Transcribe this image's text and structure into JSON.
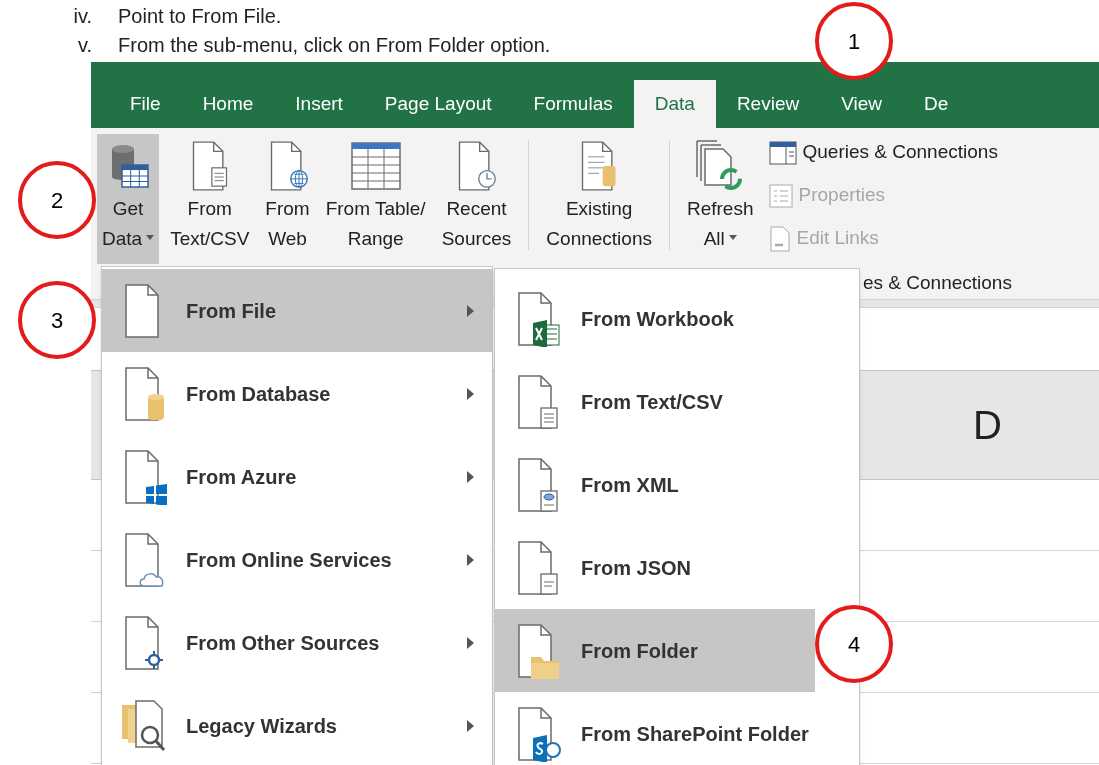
{
  "instructions": [
    {
      "number": "iv.",
      "text": "Point to From File."
    },
    {
      "number": "v.",
      "text": "From the sub-menu, click on From Folder option."
    }
  ],
  "tabs": [
    {
      "label": "File",
      "selected": false
    },
    {
      "label": "Home",
      "selected": false
    },
    {
      "label": "Insert",
      "selected": false
    },
    {
      "label": "Page Layout",
      "selected": false
    },
    {
      "label": "Formulas",
      "selected": false
    },
    {
      "label": "Data",
      "selected": true
    },
    {
      "label": "Review",
      "selected": false
    },
    {
      "label": "View",
      "selected": false
    },
    {
      "label": "De",
      "selected": false
    }
  ],
  "ribbon": {
    "large_buttons": [
      {
        "lines": [
          "Get",
          "Data"
        ],
        "has_menu": true,
        "selected": true
      },
      {
        "lines": [
          "From",
          "Text/CSV"
        ],
        "has_menu": false,
        "selected": false
      },
      {
        "lines": [
          "From",
          "Web"
        ],
        "has_menu": false,
        "selected": false
      },
      {
        "lines": [
          "From Table/",
          "Range"
        ],
        "has_menu": false,
        "selected": false
      },
      {
        "lines": [
          "Recent",
          "Sources"
        ],
        "has_menu": false,
        "selected": false
      },
      {
        "lines": [
          "Existing",
          "Connections"
        ],
        "has_menu": false,
        "selected": false
      },
      {
        "lines": [
          "Refresh",
          "All"
        ],
        "has_menu": true,
        "selected": false
      }
    ],
    "small_buttons": [
      {
        "label": "Queries & Connections",
        "disabled": false
      },
      {
        "label": "Properties",
        "disabled": true
      },
      {
        "label": "Edit Links",
        "disabled": true
      }
    ],
    "group_label": "es & Connections"
  },
  "sheet": {
    "column_header": "D"
  },
  "menu": [
    {
      "label": "From File",
      "selected": true,
      "submenu": true
    },
    {
      "label": "From Database",
      "selected": false,
      "submenu": true
    },
    {
      "label": "From Azure",
      "selected": false,
      "submenu": true
    },
    {
      "label": "From Online Services",
      "selected": false,
      "submenu": true
    },
    {
      "label": "From Other Sources",
      "selected": false,
      "submenu": true
    },
    {
      "label": "Legacy Wizards",
      "selected": false,
      "submenu": true
    }
  ],
  "submenu": [
    {
      "label": "From Workbook",
      "selected": false
    },
    {
      "label": "From Text/CSV",
      "selected": false
    },
    {
      "label": "From XML",
      "selected": false
    },
    {
      "label": "From JSON",
      "selected": false
    },
    {
      "label": "From Folder",
      "selected": true
    },
    {
      "label": "From SharePoint Folder",
      "selected": false
    }
  ],
  "annotations": [
    {
      "label": "1"
    },
    {
      "label": "2"
    },
    {
      "label": "3"
    },
    {
      "label": "4"
    }
  ]
}
